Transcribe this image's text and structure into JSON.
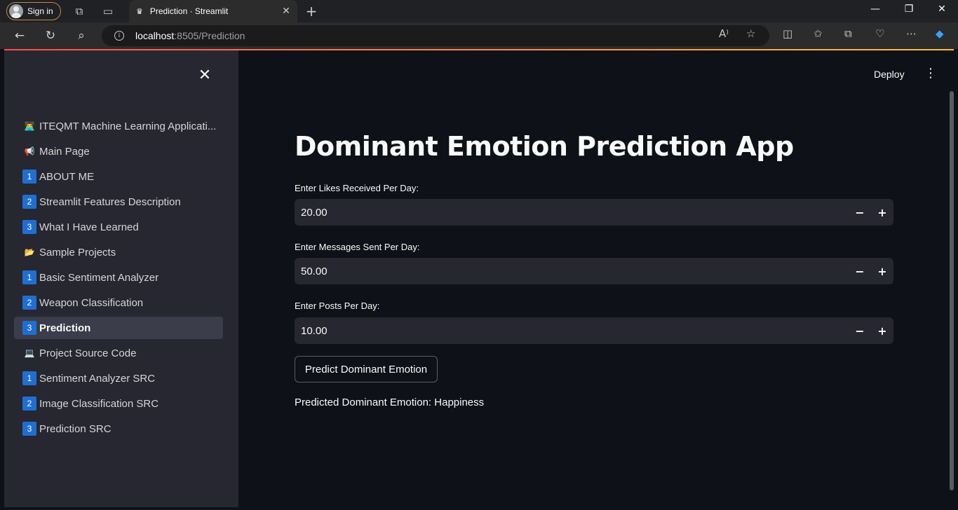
{
  "browser": {
    "signin_label": "Sign in",
    "tab_title": "Prediction · Streamlit",
    "url_host": "localhost",
    "url_path": ":8505/Prediction"
  },
  "sidebar": {
    "items": [
      {
        "icon": "👨‍💻",
        "label": "ITEQMT Machine Learning Applicati...",
        "type": "emoji"
      },
      {
        "icon": "📢",
        "label": "Main Page",
        "type": "emoji"
      },
      {
        "icon": "1",
        "label": "ABOUT ME",
        "type": "num"
      },
      {
        "icon": "2",
        "label": "Streamlit Features Description",
        "type": "num"
      },
      {
        "icon": "3",
        "label": "What I Have Learned",
        "type": "num"
      },
      {
        "icon": "📂",
        "label": "Sample Projects",
        "type": "emoji"
      },
      {
        "icon": "1",
        "label": "Basic Sentiment Analyzer",
        "type": "num"
      },
      {
        "icon": "2",
        "label": "Weapon Classification",
        "type": "num"
      },
      {
        "icon": "3",
        "label": "Prediction",
        "type": "num",
        "active": true
      },
      {
        "icon": "💻",
        "label": "Project Source Code",
        "type": "emoji"
      },
      {
        "icon": "1",
        "label": "Sentiment Analyzer SRC",
        "type": "num"
      },
      {
        "icon": "2",
        "label": "Image Classification SRC",
        "type": "num"
      },
      {
        "icon": "3",
        "label": "Prediction SRC",
        "type": "num"
      }
    ]
  },
  "header": {
    "deploy_label": "Deploy"
  },
  "main": {
    "title": "Dominant Emotion Prediction App",
    "inputs": [
      {
        "label": "Enter Likes Received Per Day:",
        "value": "20.00"
      },
      {
        "label": "Enter Messages Sent Per Day:",
        "value": "50.00"
      },
      {
        "label": "Enter Posts Per Day:",
        "value": "10.00"
      }
    ],
    "button_label": "Predict Dominant Emotion",
    "result_text": "Predicted Dominant Emotion: Happiness"
  },
  "colors": {
    "accent": "#ff4b4b",
    "sidebar_bg": "#262730",
    "main_bg": "#0e1117",
    "number_badge": "#1f6fd1"
  }
}
